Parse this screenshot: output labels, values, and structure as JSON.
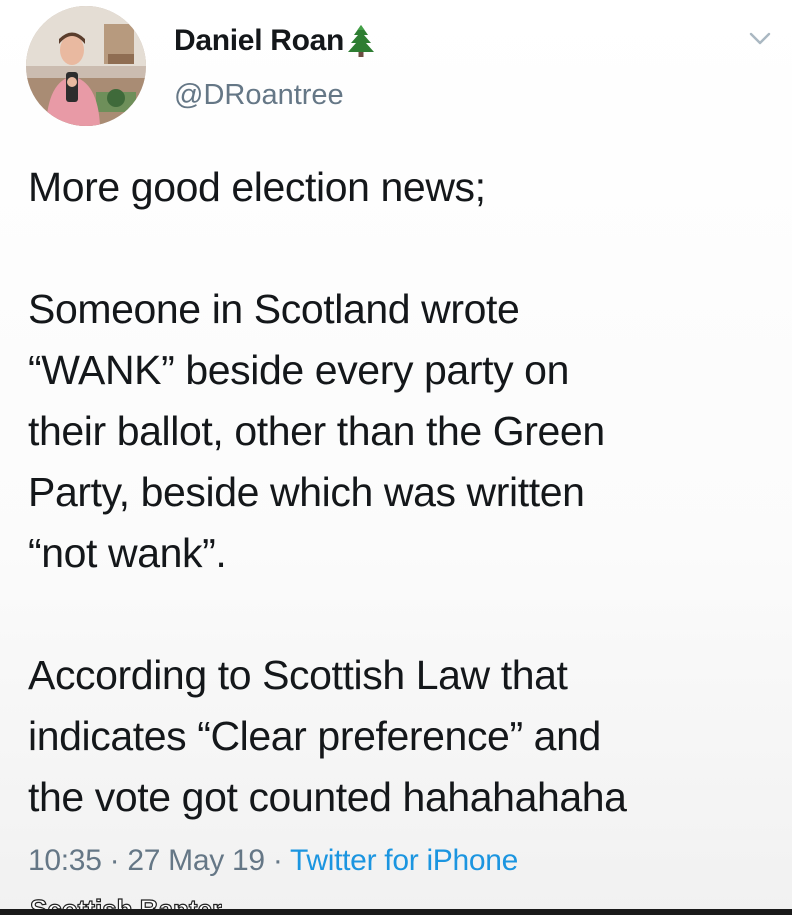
{
  "tweet": {
    "display_name": "Daniel Roan",
    "name_emoji_icon": "evergreen-tree-icon",
    "handle": "@DRoantree",
    "menu_icon": "chevron-down-icon",
    "lines": [
      "More good election news;",
      "",
      "Someone in Scotland wrote",
      "“WANK” beside every party on",
      "their ballot, other than the Green",
      "Party, beside which was written",
      "“not wank”.",
      "",
      "According to Scottish Law that",
      "indicates “Clear preference” and",
      "the vote got counted hahahahaha"
    ],
    "time": "10:35",
    "separator": "·",
    "date": "27 May 19",
    "source": "Twitter for iPhone"
  },
  "watermark": "Scottish Banter",
  "colors": {
    "text": "#14171a",
    "secondary": "#657786",
    "link": "#1b95e0"
  }
}
